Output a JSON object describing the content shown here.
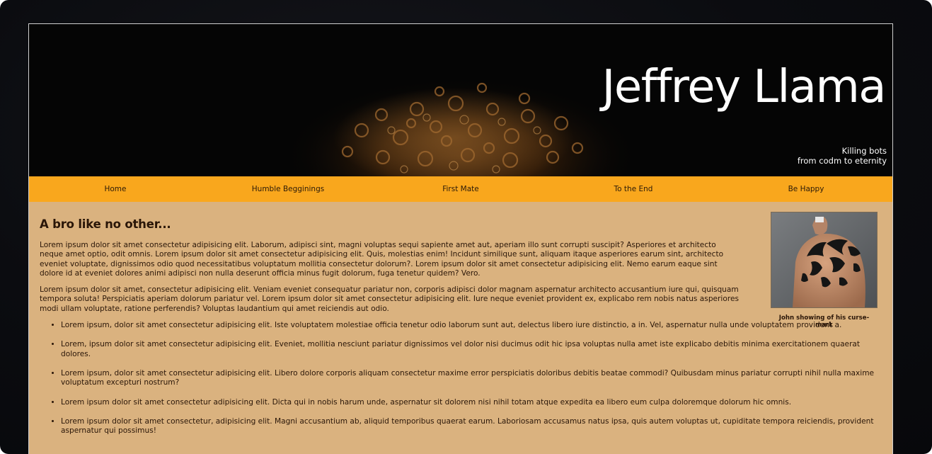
{
  "header": {
    "title": "Jeffrey Llama",
    "tagline_lines": [
      "Killing bots",
      "from codm to eternity"
    ]
  },
  "nav": {
    "items": [
      "Home",
      "Humble Begginings",
      "First Mate",
      "To the End",
      "Be Happy"
    ]
  },
  "main": {
    "heading": "A bro like no other...",
    "paragraphs": [
      "Lorem ipsum dolor sit amet consectetur adipisicing elit. Laborum, adipisci sint, magni voluptas sequi sapiente amet aut, aperiam illo sunt corrupti suscipit? Asperiores et architecto neque amet optio, odit omnis. Lorem ipsum dolor sit amet consectetur adipisicing elit. Quis, molestias enim! Incidunt similique sunt, aliquam itaque asperiores earum sint, architecto eveniet voluptate, dignissimos odio quod necessitatibus voluptatum mollitia consectetur dolorum?. Lorem ipsum dolor sit amet consectetur adipisicing elit. Nemo earum eaque sint dolore id at eveniet dolores animi adipisci non nulla deserunt officia minus fugit dolorum, fuga tenetur quidem? Vero.",
      "Lorem ipsum dolor sit amet, consectetur adipisicing elit. Veniam eveniet consequatur pariatur non, corporis adipisci dolor magnam aspernatur architecto accusantium iure qui, quisquam tempora soluta! Perspiciatis aperiam dolorum pariatur vel. Lorem ipsum dolor sit amet consectetur adipisicing elit. Iure neque eveniet provident ex, explicabo rem nobis natus asperiores modi ullam voluptate, ratione perferendis? Voluptas laudantium qui amet reiciendis aut odio."
    ],
    "bullets": [
      "Lorem ipsum, dolor sit amet consectetur adipisicing elit. Iste voluptatem molestiae officia tenetur odio laborum sunt aut, delectus libero iure distinctio, a in. Vel, aspernatur nulla unde voluptatem provident a.",
      "Lorem, ipsum dolor sit amet consectetur adipisicing elit. Eveniet, mollitia nesciunt pariatur dignissimos vel dolor nisi ducimus odit hic ipsa voluptas nulla amet iste explicabo debitis minima exercitationem quaerat dolores.",
      "Lorem ipsum, dolor sit amet consectetur adipisicing elit. Libero dolore corporis aliquam consectetur maxime error perspiciatis doloribus debitis beatae commodi? Quibusdam minus pariatur corrupti nihil nulla maxime voluptatum excepturi nostrum?",
      "Lorem ipsum dolor sit amet consectetur adipisicing elit. Dicta qui in nobis harum unde, aspernatur sit dolorem nisi nihil totam atque expedita ea libero eum culpa doloremque dolorum hic omnis.",
      "Lorem ipsum dolor sit amet consectetur, adipisicing elit. Magni accusantium ab, aliquid temporibus quaerat earum. Laboriosam accusamus natus ipsa, quis autem voluptas ut, cupiditate tempora reiciendis, provident aspernatur qui possimus!"
    ],
    "figure": {
      "caption": "John showing of his curse-mark"
    }
  },
  "colors": {
    "nav_background": "#f9a71d",
    "content_background": "#dab27f",
    "hero_background": "#050505",
    "text": "#2a1608"
  },
  "icons": {
    "hero_image": "curly-hair-photo",
    "figure_image": "shoulder-tattoo-photo"
  }
}
